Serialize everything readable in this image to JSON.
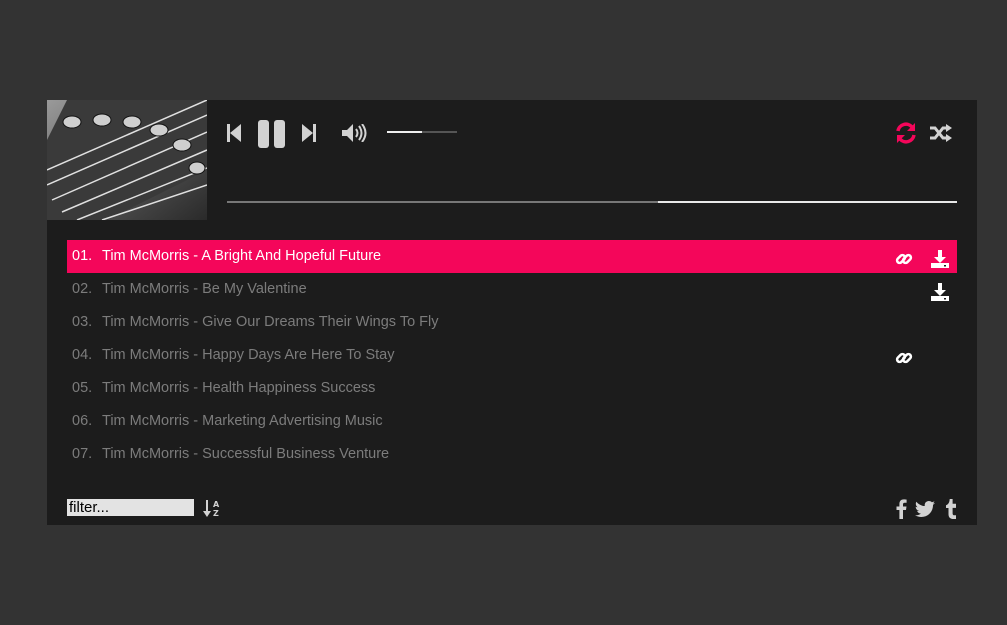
{
  "player": {
    "volume_level": 0.5,
    "progress_level": 0.59,
    "colors": {
      "accent": "#f4065a",
      "panel": "#1c1c1c",
      "background": "#333333",
      "inactive_text": "#7c7c7c"
    }
  },
  "controls": {
    "icons": [
      "skip-back-icon",
      "pause-icon",
      "skip-forward-icon",
      "volume-icon",
      "repeat-icon",
      "shuffle-icon"
    ]
  },
  "playlist": [
    {
      "num": "01.",
      "title": "Tim McMorris - A Bright And Hopeful Future",
      "active": true,
      "link": true,
      "download": true
    },
    {
      "num": "02.",
      "title": "Tim McMorris - Be My Valentine",
      "active": false,
      "link": false,
      "download": true
    },
    {
      "num": "03.",
      "title": "Tim McMorris - Give Our Dreams Their Wings To Fly",
      "active": false,
      "link": false,
      "download": false
    },
    {
      "num": "04.",
      "title": "Tim McMorris - Happy Days Are Here To Stay",
      "active": false,
      "link": true,
      "download": false
    },
    {
      "num": "05.",
      "title": "Tim McMorris - Health Happiness Success",
      "active": false,
      "link": false,
      "download": false
    },
    {
      "num": "06.",
      "title": "Tim McMorris - Marketing Advertising Music",
      "active": false,
      "link": false,
      "download": false
    },
    {
      "num": "07.",
      "title": "Tim McMorris - Successful Business Venture",
      "active": false,
      "link": false,
      "download": false
    }
  ],
  "footer": {
    "filter_placeholder": "filter...",
    "social_icons": [
      "facebook-icon",
      "twitter-icon",
      "tumblr-icon"
    ]
  }
}
